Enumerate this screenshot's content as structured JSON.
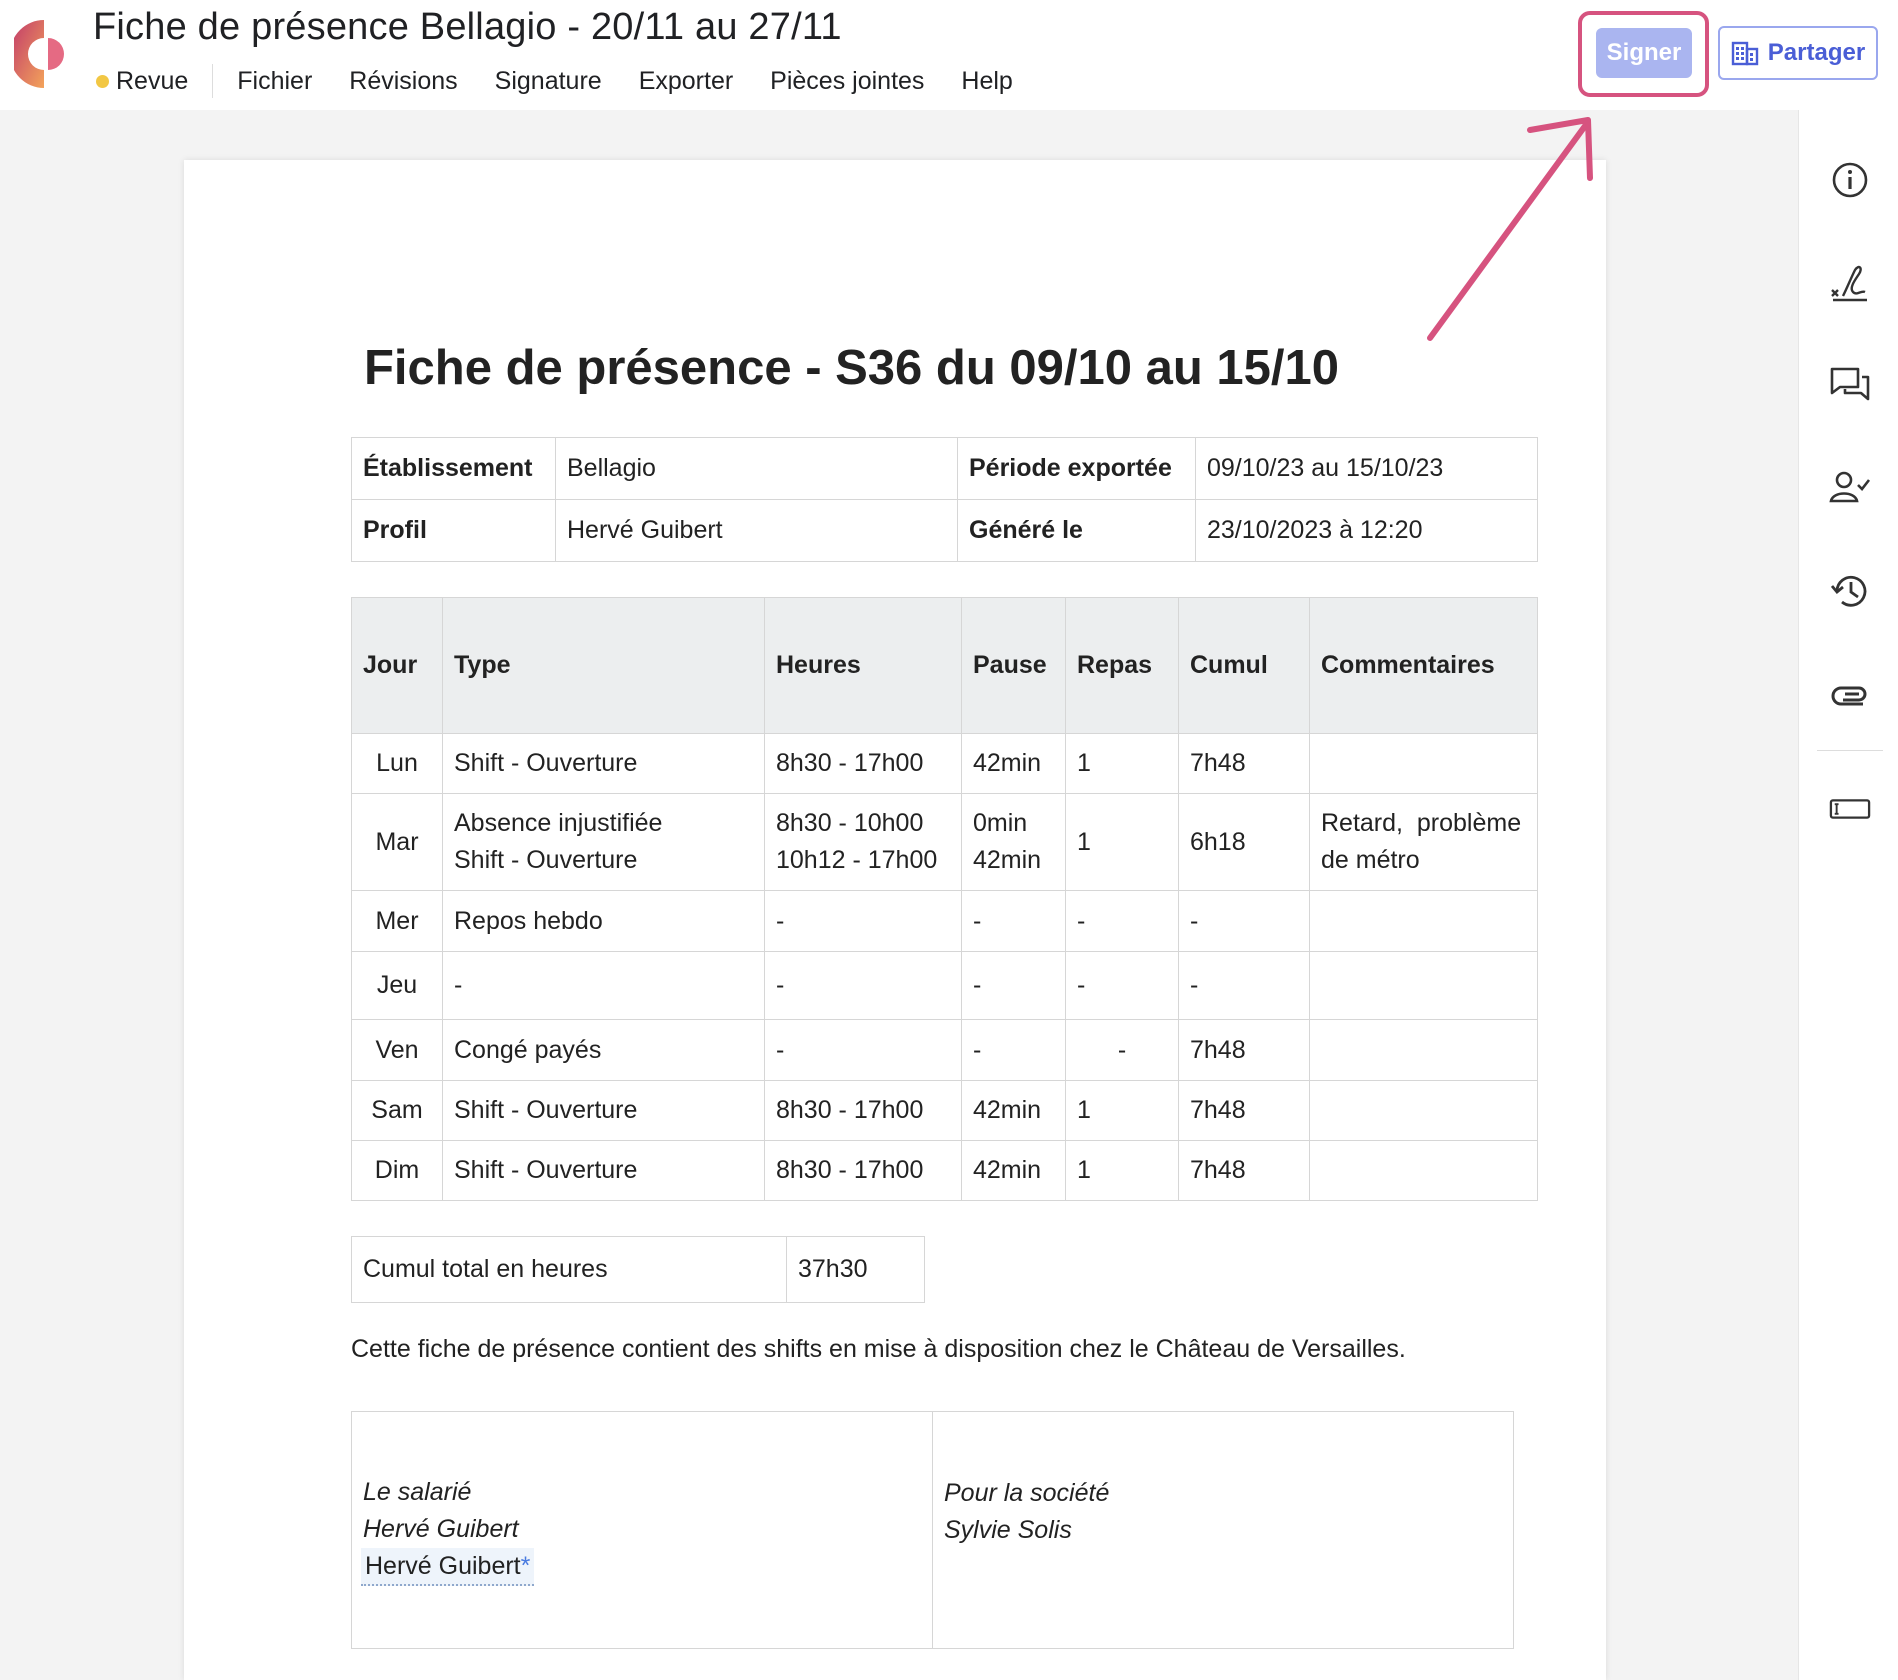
{
  "header": {
    "doc_title": "Fiche de présence Bellagio - 20/11 au 27/11",
    "status_label": "Revue",
    "status_color": "#f2c744",
    "menu": [
      "Fichier",
      "Révisions",
      "Signature",
      "Exporter",
      "Pièces jointes",
      "Help"
    ],
    "sign_label": "Signer",
    "share_label": "Partager",
    "accent_color": "#4a5ed6",
    "highlight_color": "#d6537f"
  },
  "right_toolbar": {
    "icons": [
      "info-icon",
      "signature-icon",
      "comments-icon",
      "user-check-icon",
      "history-icon",
      "paperclip-icon",
      "text-field-icon"
    ]
  },
  "document": {
    "heading": "Fiche de présence - S36 du 09/10 au 15/10",
    "info": {
      "etablissement_label": "Établissement",
      "etablissement_value": "Bellagio",
      "periode_label": "Période exportée",
      "periode_value": "09/10/23 au 15/10/23",
      "profil_label": "Profil",
      "profil_value": "Hervé Guibert",
      "genere_label": "Généré le",
      "genere_value": "23/10/2023 à 12:20"
    },
    "days_table": {
      "headers": [
        "Jour",
        "Type",
        "Heures",
        "Pause",
        "Repas",
        "Cumul",
        "Commentaires"
      ],
      "rows": [
        {
          "jour": "Lun",
          "type": "Shift - Ouverture",
          "heures": "8h30 - 17h00",
          "pause": "42min",
          "repas": "1",
          "cumul": "7h48",
          "commentaires": ""
        },
        {
          "jour": "Mar",
          "type_1": "Absence injustifiée",
          "type_2": "Shift - Ouverture",
          "heures_1": "8h30 - 10h00",
          "heures_2": "10h12 - 17h00",
          "pause_1": "0min",
          "pause_2": "42min",
          "repas": "1",
          "cumul": "6h18",
          "commentaires_1": "Retard,  problème",
          "commentaires_2": "de métro"
        },
        {
          "jour": "Mer",
          "type": "Repos hebdo",
          "heures": "-",
          "pause": "-",
          "repas": "-",
          "cumul": "-",
          "commentaires": ""
        },
        {
          "jour": "Jeu",
          "type": "-",
          "heures": "-",
          "pause": "-",
          "repas": "-",
          "cumul": "-",
          "commentaires": ""
        },
        {
          "jour": "Ven",
          "type": "Congé payés",
          "heures": "-",
          "pause": "-",
          "repas": "-",
          "cumul": "7h48",
          "commentaires": ""
        },
        {
          "jour": "Sam",
          "type": "Shift - Ouverture",
          "heures": "8h30 - 17h00",
          "pause": "42min",
          "repas": "1",
          "cumul": "7h48",
          "commentaires": ""
        },
        {
          "jour": "Dim",
          "type": "Shift - Ouverture",
          "heures": "8h30 - 17h00",
          "pause": "42min",
          "repas": "1",
          "cumul": "7h48",
          "commentaires": ""
        }
      ]
    },
    "total": {
      "label": "Cumul total en heures",
      "value": "37h30"
    },
    "note": "Cette fiche de présence contient des shifts en mise à disposition chez le Château de Versailles.",
    "signatures": {
      "employee_title": "Le salarié",
      "employee_name": "Hervé Guibert",
      "employee_signature_field": "Hervé Guibert",
      "required_marker": "*",
      "company_title": "Pour la société",
      "company_name": "Sylvie Solis"
    }
  }
}
